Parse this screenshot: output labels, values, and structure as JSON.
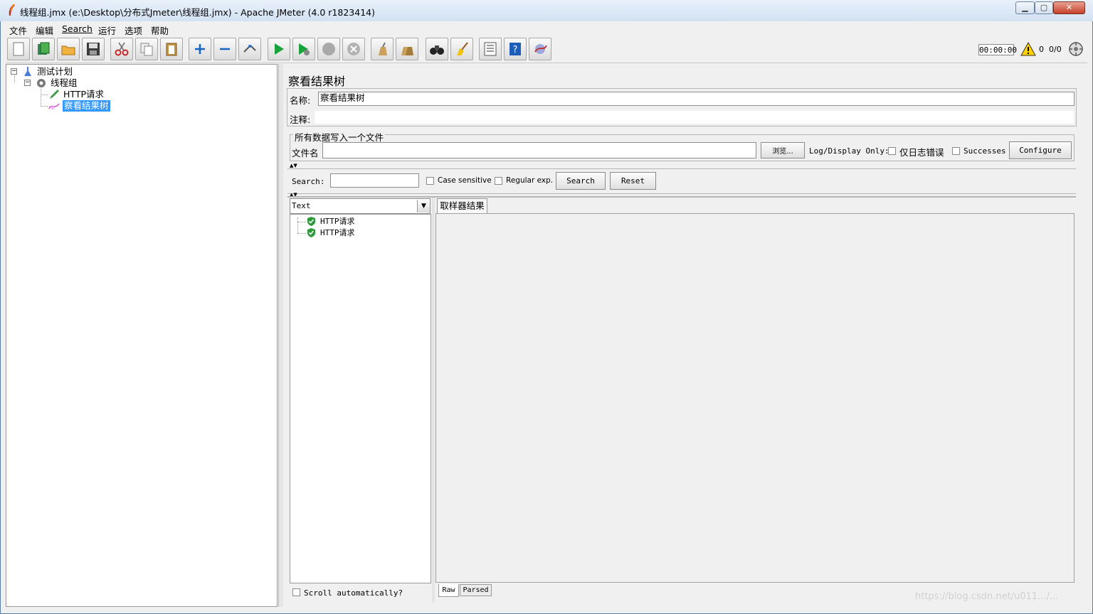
{
  "window": {
    "title": "线程组.jmx (e:\\Desktop\\分布式Jmeter\\线程组.jmx) - Apache JMeter (4.0 r1823414)",
    "minimize": "▁",
    "maximize": "▢",
    "close": "✕"
  },
  "menu": [
    "文件",
    "编辑",
    "Search",
    "运行",
    "选项",
    "帮助"
  ],
  "toolbar": {
    "timer": "00:00:00",
    "warning_count": "0",
    "thread_count": "0/0",
    "icons": [
      "new-icon",
      "templates-icon",
      "open-icon",
      "save-icon",
      "cut-icon",
      "copy-icon",
      "paste-icon",
      "expand-icon",
      "collapse-icon",
      "toggle-icon",
      "start-icon",
      "start-no-pause-icon",
      "stop-icon",
      "shutdown-icon",
      "clear-icon",
      "clear-all-icon",
      "search-icon",
      "reset-search-icon",
      "function-helper-icon",
      "help-icon",
      "remote-icon"
    ]
  },
  "tree": {
    "plan": "测试计划",
    "thread_group": "线程组",
    "http_request": "HTTP请求",
    "listener": "察看结果树"
  },
  "panel": {
    "title": "察看结果树",
    "name_label": "名称:",
    "name_value": "察看结果树",
    "comment_label": "注释:",
    "comment_value": "",
    "file_group_title": "所有数据写入一个文件",
    "filename_label": "文件名",
    "filename_value": "",
    "browse_button": "浏览...",
    "log_display_only": "Log/Display Only:",
    "errors_only": "仅日志错误",
    "successes": "Successes",
    "configure_button": "Configure"
  },
  "search": {
    "label": "Search:",
    "value": "",
    "case_sensitive": "Case sensitive",
    "regular_exp": "Regular exp.",
    "search_button": "Search",
    "reset_button": "Reset"
  },
  "results": {
    "renderer": "Text",
    "samples": [
      "HTTP请求",
      "HTTP请求"
    ],
    "scroll_auto": "Scroll automatically?",
    "tab": "取样器结果",
    "bottom_tabs": [
      "Raw",
      "Parsed"
    ]
  },
  "watermark": "https://blog.csdn.net/u011.../..."
}
